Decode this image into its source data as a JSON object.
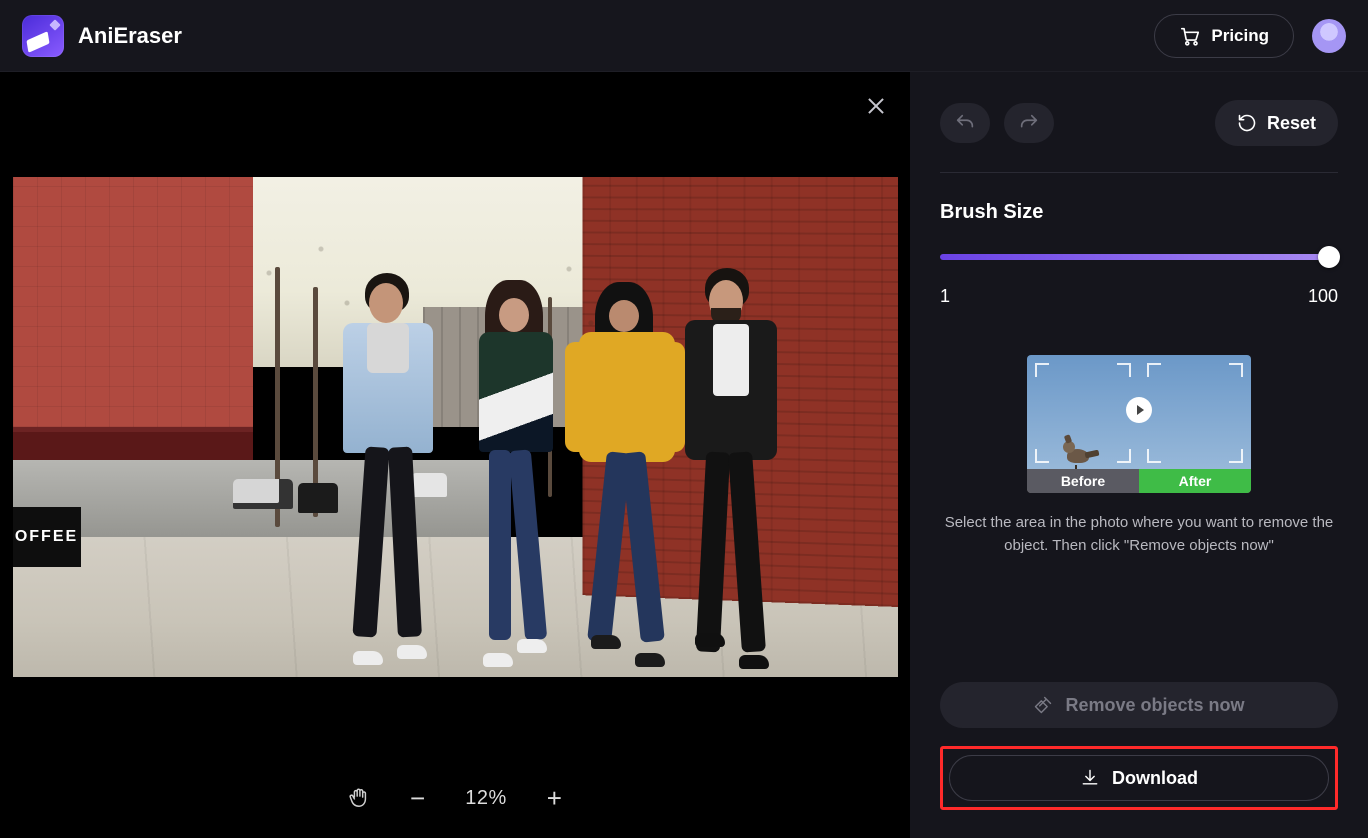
{
  "header": {
    "app_name": "AniEraser",
    "pricing_label": "Pricing"
  },
  "canvas": {
    "zoom_label": "12%",
    "coffee_sign": "OFFEE"
  },
  "sidebar": {
    "reset_label": "Reset",
    "brush_label": "Brush Size",
    "brush_min": "1",
    "brush_max": "100",
    "brush_value": 100,
    "preview_before": "Before",
    "preview_after": "After",
    "help_text": "Select the area in the photo where you want to remove the object. Then click \"Remove objects now\"",
    "remove_label": "Remove objects now",
    "download_label": "Download"
  },
  "colors": {
    "accent": "#8a5cff",
    "highlight_box": "#ff2a2a",
    "after_badge": "#3fbc47"
  }
}
